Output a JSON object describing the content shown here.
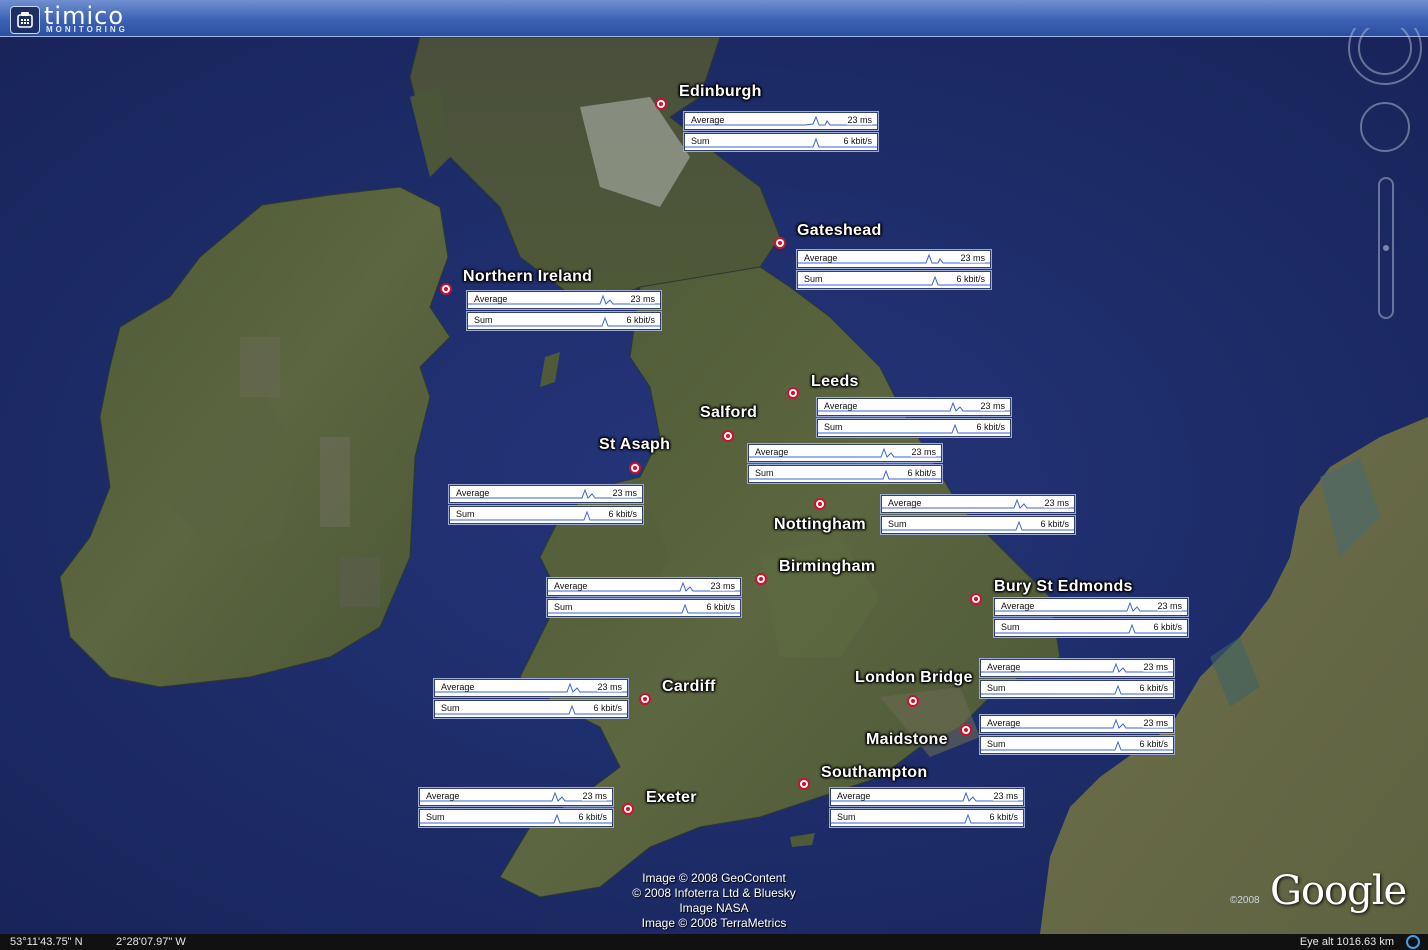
{
  "app": {
    "brand": "timico",
    "subtitle": "MONITORING"
  },
  "metric_labels": {
    "average": "Average",
    "sum": "Sum"
  },
  "locations": [
    {
      "name": "Edinburgh",
      "average": "23 ms",
      "sum": "6 kbit/s"
    },
    {
      "name": "Gateshead",
      "average": "23 ms",
      "sum": "6 kbit/s"
    },
    {
      "name": "Northern Ireland",
      "average": "23 ms",
      "sum": "6 kbit/s"
    },
    {
      "name": "Leeds",
      "average": "23 ms",
      "sum": "6 kbit/s"
    },
    {
      "name": "Salford",
      "average": "23 ms",
      "sum": "6 kbit/s"
    },
    {
      "name": "St Asaph",
      "average": "23 ms",
      "sum": "6 kbit/s"
    },
    {
      "name": "Nottingham",
      "average": "23 ms",
      "sum": "6 kbit/s"
    },
    {
      "name": "Birmingham",
      "average": "23 ms",
      "sum": "6 kbit/s"
    },
    {
      "name": "Bury St Edmonds",
      "average": "23 ms",
      "sum": "6 kbit/s"
    },
    {
      "name": "London Bridge",
      "average": "23 ms",
      "sum": "6 kbit/s"
    },
    {
      "name": "Maidstone",
      "average": "23 ms",
      "sum": "6 kbit/s"
    },
    {
      "name": "Cardiff",
      "average": "23 ms",
      "sum": "6 kbit/s"
    },
    {
      "name": "Southampton",
      "average": "23 ms",
      "sum": "6 kbit/s"
    },
    {
      "name": "Exeter",
      "average": "23 ms",
      "sum": "6 kbit/s"
    }
  ],
  "attribution": [
    "Image © 2008 GeoContent",
    "© 2008 Infoterra Ltd & Bluesky",
    "Image NASA",
    "Image © 2008 TerraMetrics"
  ],
  "google": {
    "logo": "Google",
    "year": "©2008"
  },
  "status": {
    "lat": "53°11'43.75\" N",
    "lon": "2°28'07.97\" W",
    "eye_alt": "Eye alt  1016.63 km"
  },
  "colors": {
    "sea": "#1b2a66",
    "land": "#4f5b37",
    "marker": "#d0102b",
    "toolbar": "#3d62b4"
  }
}
